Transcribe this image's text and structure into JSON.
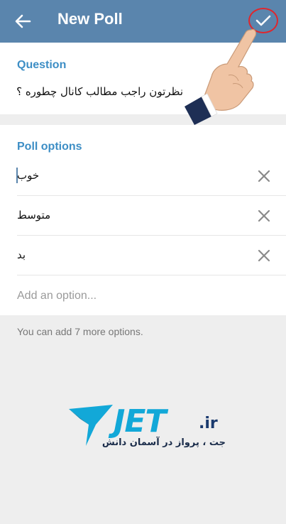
{
  "appbar": {
    "title": "New Poll",
    "back_icon": "arrow-left-icon",
    "done_icon": "check-icon",
    "bg_color": "#5a85ad"
  },
  "question": {
    "label": "Question",
    "value": "نظرتون راجب مطالب کانال چطوره ؟"
  },
  "poll_options": {
    "label": "Poll options",
    "items": [
      {
        "text": "خوب"
      },
      {
        "text": "متوسط"
      },
      {
        "text": "بد"
      }
    ],
    "add_placeholder": "Add an option...",
    "hint": "You can add 7 more options."
  },
  "watermark": {
    "brand": "JET",
    "tld": ".ir",
    "tagline": "جت ، پرواز در آسمان دانش",
    "accent_color": "#12a8d8"
  },
  "colors": {
    "accent": "#3d8ec5",
    "highlight_circle": "#e0262c"
  }
}
